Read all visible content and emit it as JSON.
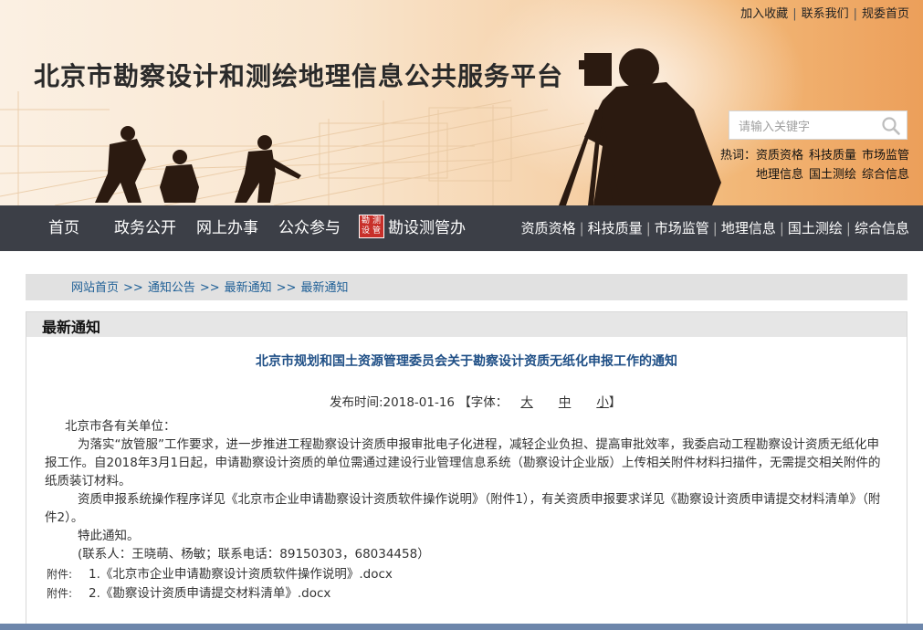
{
  "top_links": [
    "加入收藏",
    "联系我们",
    "规委首页"
  ],
  "site_title": "北京市勘察设计和测绘地理信息公共服务平台",
  "search": {
    "placeholder": "请输入关键字",
    "icon": "search-icon"
  },
  "hotwords": {
    "label": "热词：",
    "row1": [
      "资质资格",
      "科技质量",
      "市场监管"
    ],
    "row2": [
      "地理信息",
      "国土测绘",
      "综合信息"
    ]
  },
  "nav": {
    "main": [
      "首页",
      "政务公开",
      "网上办事",
      "公众参与",
      "勘设测管办"
    ],
    "logo_text": [
      "勘",
      "测",
      "设",
      "管"
    ],
    "right": [
      "资质资格",
      "科技质量",
      "市场监管",
      "地理信息",
      "国土测绘",
      "综合信息"
    ]
  },
  "breadcrumb": [
    "网站首页",
    "通知公告",
    "最新通知",
    "最新通知"
  ],
  "breadcrumb_sep": ">>",
  "panel_title": "最新通知",
  "article": {
    "title": "北京市规划和国土资源管理委员会关于勘察设计资质无纸化申报工作的通知",
    "date_label": "发布时间:2018-01-16",
    "font_label_open": "【字体：",
    "font_sizes": [
      "大",
      "中",
      "小"
    ],
    "font_label_close": "】",
    "paragraphs": [
      "北京市各有关单位：",
      "为落实“放管服”工作要求，进一步推进工程勘察设计资质申报审批电子化进程，减轻企业负担、提高审批效率，我委启动工程勘察设计资质无纸化申报工作。自2018年3月1日起，申请勘察设计资质的单位需通过建设行业管理信息系统（勘察设计企业版）上传相关附件材料扫描件，无需提交相关附件的纸质装订材料。",
      "资质申报系统操作程序详见《北京市企业申请勘察设计资质软件操作说明》（附件1），有关资质申报要求详见《勘察设计资质申请提交材料清单》（附件2）。",
      "特此通知。",
      "(联系人：王晓萌、杨敏；联系电话：89150303，68034458）"
    ],
    "attachments": [
      {
        "label": "附件:",
        "file": "1.《北京市企业申请勘察设计资质软件操作说明》.docx"
      },
      {
        "label": "附件:",
        "file": "2.《勘察设计资质申请提交材料清单》.docx"
      }
    ]
  },
  "colors": {
    "nav_bg": "#3c3f47",
    "title_blue": "#1f4f86",
    "link_blue": "#1e5f96"
  }
}
